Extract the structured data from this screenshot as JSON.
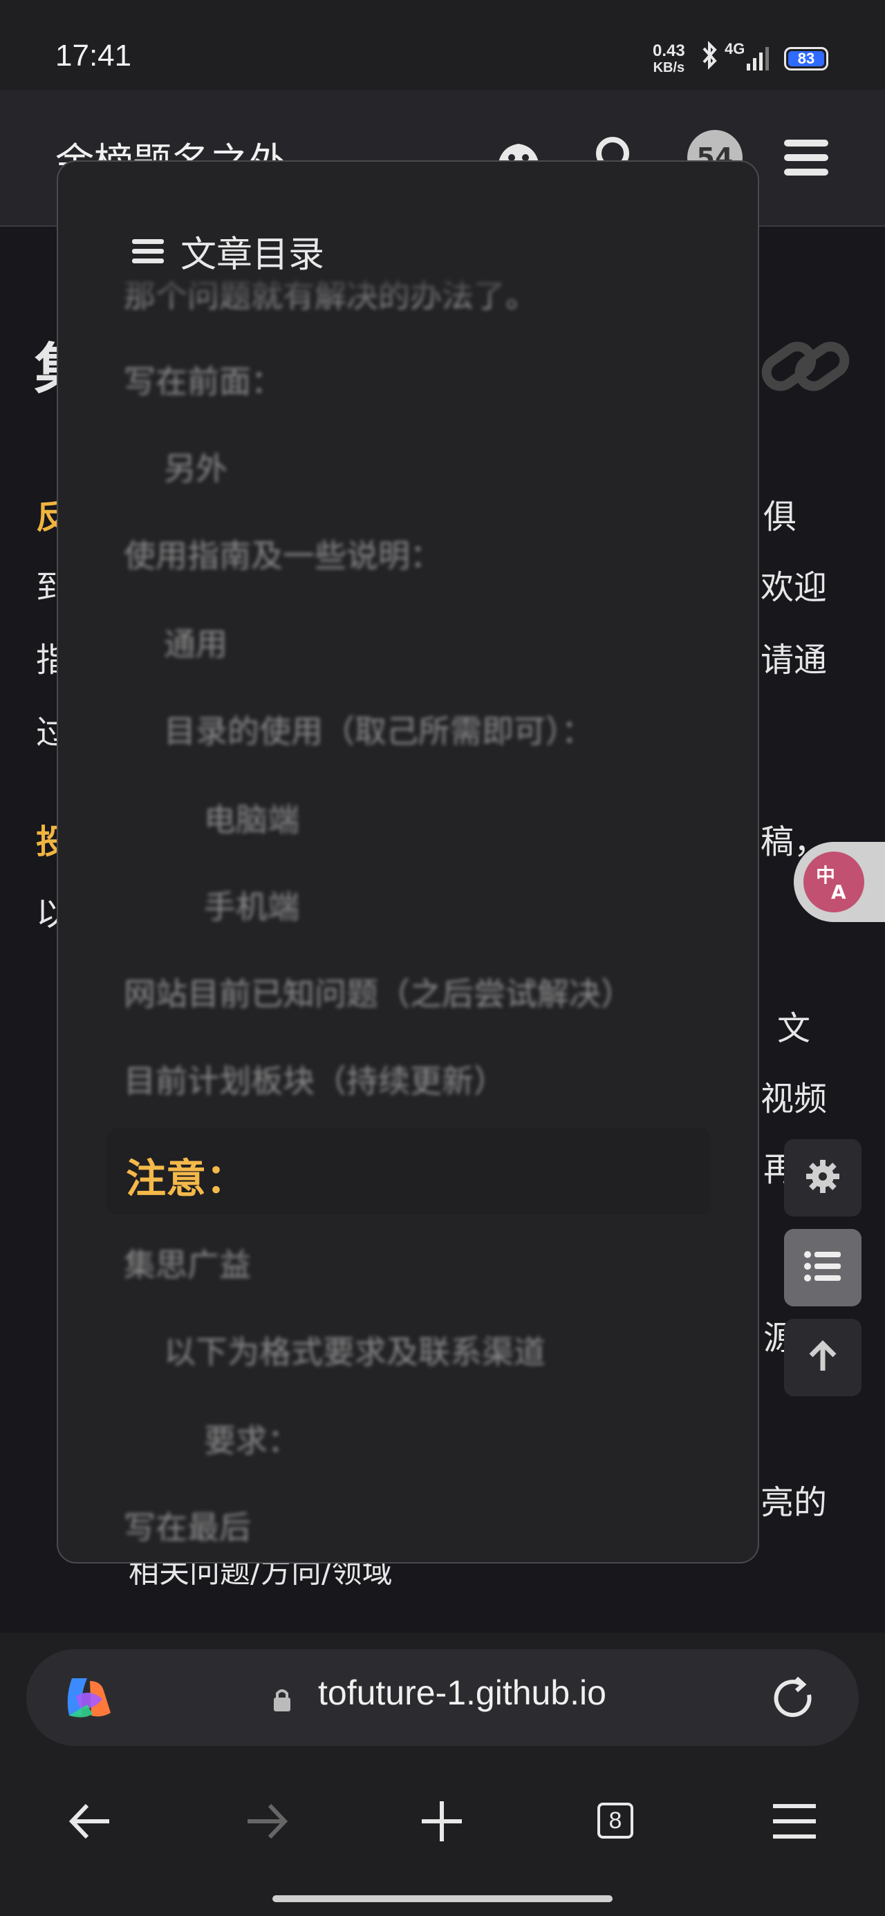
{
  "status": {
    "time": "17:41",
    "net_speed_top": "0.43",
    "net_speed_unit": "KB/s",
    "network": "4G",
    "battery": "83"
  },
  "header": {
    "title": "余榜题名之外",
    "avatar_text": "54"
  },
  "article": {
    "right_fragments": [
      "俱",
      "欢迎",
      "请通",
      "稿，",
      "文",
      "视频",
      "再插",
      "源",
      "亮的"
    ],
    "left_fragments": [
      "反",
      "到",
      "指",
      "过",
      "投",
      "以"
    ],
    "heading_fragment": "集",
    "bottom_line": "相关问题/方向/领域"
  },
  "toc": {
    "title": "文章目录",
    "items": [
      {
        "label": "那个问题就有解决的办法了。",
        "level": 1
      },
      {
        "label": "写在前面：",
        "level": 1
      },
      {
        "label": "另外",
        "level": 2
      },
      {
        "label": "使用指南及一些说明：",
        "level": 1
      },
      {
        "label": "通用",
        "level": 2
      },
      {
        "label": "目录的使用（取己所需即可）：",
        "level": 2
      },
      {
        "label": "电脑端",
        "level": 3
      },
      {
        "label": "手机端",
        "level": 3
      },
      {
        "label": "网站目前已知问题（之后尝试解决）",
        "level": 1
      },
      {
        "label": "目前计划板块（持续更新）",
        "level": 1
      },
      {
        "label": "集思广益",
        "level": 1
      },
      {
        "label": "以下为格式要求及联系渠道",
        "level": 2
      },
      {
        "label": "要求：",
        "level": 3
      },
      {
        "label": "写在最后",
        "level": 1
      }
    ],
    "active_label": "注意："
  },
  "browser": {
    "url": "tofuture-1.github.io",
    "tab_count": "8"
  },
  "colors": {
    "accent": "#f5b94a",
    "background": "#17171c",
    "panel": "#232326"
  }
}
